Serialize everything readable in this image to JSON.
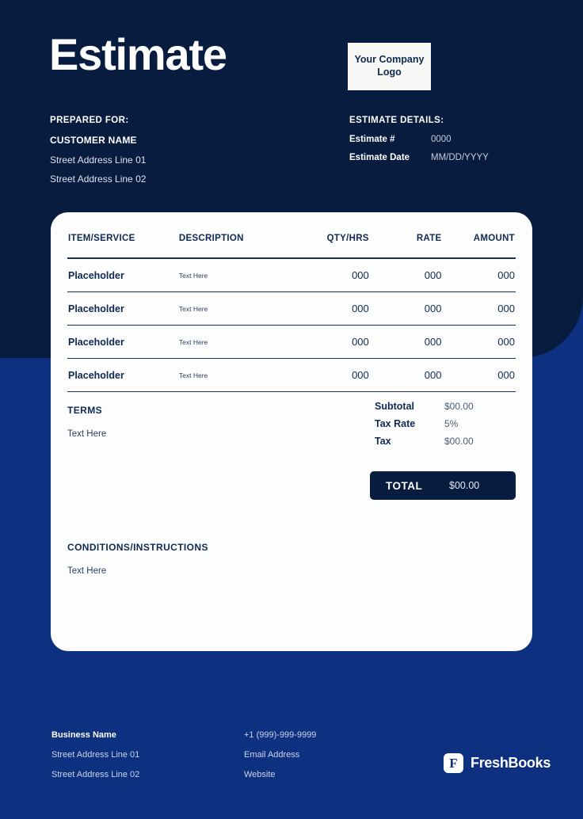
{
  "colors": {
    "navy_dark": "#081c3f",
    "blue_mid": "#0d3080",
    "card_white": "#fdfdfd",
    "text_navy": "#0e2a52"
  },
  "header": {
    "title": "Estimate",
    "logo_placeholder": "Your Company Logo"
  },
  "prepared_for": {
    "heading": "PREPARED FOR:",
    "customer_name": "CUSTOMER NAME",
    "address_line_1": "Street Address Line 01",
    "address_line_2": "Street Address Line 02"
  },
  "estimate_details": {
    "heading": "ESTIMATE DETAILS:",
    "rows": [
      {
        "label": "Estimate #",
        "value": "0000"
      },
      {
        "label": "Estimate Date",
        "value": "MM/DD/YYYY"
      }
    ]
  },
  "items_table": {
    "columns": [
      "ITEM/SERVICE",
      "DESCRIPTION",
      "QTY/HRS",
      "RATE",
      "AMOUNT"
    ],
    "rows": [
      {
        "item": "Placeholder",
        "description": "Text Here",
        "qty": "000",
        "rate": "000",
        "amount": "000"
      },
      {
        "item": "Placeholder",
        "description": "Text Here",
        "qty": "000",
        "rate": "000",
        "amount": "000"
      },
      {
        "item": "Placeholder",
        "description": "Text Here",
        "qty": "000",
        "rate": "000",
        "amount": "000"
      },
      {
        "item": "Placeholder",
        "description": "Text Here",
        "qty": "000",
        "rate": "000",
        "amount": "000"
      }
    ]
  },
  "terms": {
    "heading": "TERMS",
    "text": "Text Here"
  },
  "totals": {
    "rows": [
      {
        "label": "Subtotal",
        "value": "$00.00"
      },
      {
        "label": "Tax Rate",
        "value": "5%"
      },
      {
        "label": "Tax",
        "value": "$00.00"
      }
    ],
    "total_label": "TOTAL",
    "total_value": "$00.00"
  },
  "conditions": {
    "heading": "CONDITIONS/INSTRUCTIONS",
    "text": "Text Here"
  },
  "footer": {
    "business_name": "Business Name",
    "address_line_1": "Street Address Line 01",
    "address_line_2": "Street Address Line 02",
    "phone": "+1 (999)-999-9999",
    "email": "Email Address",
    "website": "Website",
    "brand_name": "FreshBooks",
    "brand_mark_letter": "F"
  }
}
